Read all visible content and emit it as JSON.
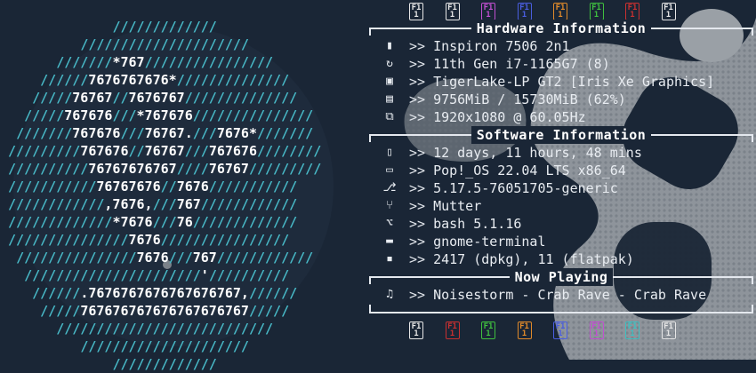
{
  "logo": {
    "lines": [
      {
        "pre": "",
        "slashes": "",
        "text": ""
      },
      {
        "pre": "              ",
        "slashes": "/////////////",
        "text": ""
      },
      {
        "pre": "          ",
        "slashes": "/////////////////////",
        "text": ""
      },
      {
        "pre": "       ",
        "slashes": "///////",
        "text": "*767",
        "slashes2": "////////////////"
      },
      {
        "pre": "     ",
        "slashes": "//////",
        "text": "7676767676*",
        "slashes2": "//////////////"
      },
      {
        "pre": "    ",
        "slashes": "/////",
        "text": "76767",
        "mid": "//",
        "text2": "7676767",
        "slashes2": "//////////////"
      },
      {
        "pre": "   ",
        "slashes": "/////",
        "text": "767676",
        "mid": "///",
        "text2": "*767676",
        "slashes2": "///////////////"
      },
      {
        "pre": "  ",
        "slashes": "///////",
        "text": "767676",
        "mid": "///",
        "text2": "76767.",
        "mid2": "///",
        "text3": "7676*",
        "slashes2": "///////"
      },
      {
        "pre": " ",
        "slashes": "/////////",
        "text": "767676",
        "mid": "//",
        "text2": "76767",
        "mid2": "///",
        "text3": "767676",
        "slashes2": "////////"
      },
      {
        "pre": " ",
        "slashes": "//////////",
        "text": "76767676767",
        "mid": "////",
        "text2": "76767",
        "slashes2": "/////////"
      },
      {
        "pre": " ",
        "slashes": "///////////",
        "text": "76767676",
        "mid": "//",
        "text2": "7676",
        "slashes2": "///////////"
      },
      {
        "pre": " ",
        "slashes": "////////////",
        "text": ",7676,",
        "mid": "///",
        "text2": "767",
        "slashes2": "////////////"
      },
      {
        "pre": " ",
        "slashes": "/////////////",
        "text": "*7676",
        "mid": "///",
        "text2": "76",
        "slashes2": "/////////////"
      },
      {
        "pre": " ",
        "slashes": "///////////////",
        "text": "7676",
        "slashes2": "////////////////"
      },
      {
        "pre": "  ",
        "slashes": "///////////////",
        "text": "7676",
        "mid": "///",
        "text2": "767",
        "slashes2": "////////////"
      },
      {
        "pre": "   ",
        "slashes": "//////////////////////",
        "text": "'",
        "slashes2": "//////////"
      },
      {
        "pre": "    ",
        "slashes": "//////",
        "text": ".7676767676767676767,",
        "slashes2": "//////"
      },
      {
        "pre": "     ",
        "slashes": "/////",
        "text": "767676767676767676767",
        "slashes2": "/////"
      },
      {
        "pre": "       ",
        "slashes": "///////////////////////////",
        "text": ""
      },
      {
        "pre": "          ",
        "slashes": "/////////////////////",
        "text": ""
      },
      {
        "pre": "              ",
        "slashes": "/////////////",
        "text": ""
      }
    ]
  },
  "palette_top": [
    {
      "label": "F1 1",
      "color": "#e6e6e6",
      "name": "palette-white-icon"
    },
    {
      "label": "F1 1",
      "color": "#e6e6e6",
      "name": "palette-white-2-icon"
    },
    {
      "label": "F1 1",
      "color": "#c04fd0",
      "name": "palette-magenta-icon"
    },
    {
      "label": "F1 1",
      "color": "#4a5ee0",
      "name": "palette-blue-icon"
    },
    {
      "label": "F1 1",
      "color": "#e08a2a",
      "name": "palette-orange-icon"
    },
    {
      "label": "F1 1",
      "color": "#3fbf3f",
      "name": "palette-green-icon"
    },
    {
      "label": "F1 1",
      "color": "#c83030",
      "name": "palette-red-icon"
    },
    {
      "label": "F1 1",
      "color": "#e6e6e6",
      "name": "palette-gray-icon"
    }
  ],
  "palette_bottom": [
    {
      "label": "F1 1",
      "color": "#e6e6e6",
      "name": "palette-white-icon"
    },
    {
      "label": "F1 1",
      "color": "#c83030",
      "name": "palette-red-icon"
    },
    {
      "label": "F1 1",
      "color": "#3fbf3f",
      "name": "palette-green-icon"
    },
    {
      "label": "F1 1",
      "color": "#e08a2a",
      "name": "palette-orange-icon"
    },
    {
      "label": "F1 1",
      "color": "#4a5ee0",
      "name": "palette-blue-icon"
    },
    {
      "label": "F1 1",
      "color": "#c04fd0",
      "name": "palette-magenta-icon"
    },
    {
      "label": "F1 1",
      "color": "#3fbfc0",
      "name": "palette-cyan-icon"
    },
    {
      "label": "F1 1",
      "color": "#e6e6e6",
      "name": "palette-gray-icon"
    }
  ],
  "hardware": {
    "title": "Hardware Information",
    "rows": [
      {
        "icon": "▮",
        "icon_name": "computer-icon",
        "value": "Inspiron 7506 2n1"
      },
      {
        "icon": "↻",
        "icon_name": "cpu-icon",
        "value": "11th Gen i7-1165G7 (8)"
      },
      {
        "icon": "▣",
        "icon_name": "gpu-icon",
        "value": "TigerLake-LP GT2 [Iris Xe Graphics]"
      },
      {
        "icon": "▤",
        "icon_name": "memory-icon",
        "value": "9756MiB / 15730MiB (62%)"
      },
      {
        "icon": "⧉",
        "icon_name": "display-icon",
        "value": "1920x1080 @ 60.05Hz"
      }
    ]
  },
  "software": {
    "title": "Software Information",
    "rows": [
      {
        "icon": "▯",
        "icon_name": "uptime-icon",
        "value": "12 days, 11 hours, 48 mins"
      },
      {
        "icon": "▭",
        "icon_name": "os-icon",
        "value": "Pop!_OS 22.04 LTS x86_64"
      },
      {
        "icon": "⎇",
        "icon_name": "kernel-icon",
        "value": "5.17.5-76051705-generic"
      },
      {
        "icon": "⑂",
        "icon_name": "window-manager-icon",
        "value": "Mutter"
      },
      {
        "icon": "⌥",
        "icon_name": "shell-icon",
        "value": "bash 5.1.16"
      },
      {
        "icon": "▬",
        "icon_name": "terminal-icon",
        "value": "gnome-terminal"
      },
      {
        "icon": "▪",
        "icon_name": "packages-icon",
        "value": "2417 (dpkg), 11 (flatpak)"
      }
    ]
  },
  "now_playing": {
    "title": "Now Playing",
    "rows": [
      {
        "icon": "♫",
        "icon_name": "music-icon",
        "value": "Noisestorm - Crab Rave - Crab Rave"
      }
    ]
  },
  "arrow": ">>"
}
